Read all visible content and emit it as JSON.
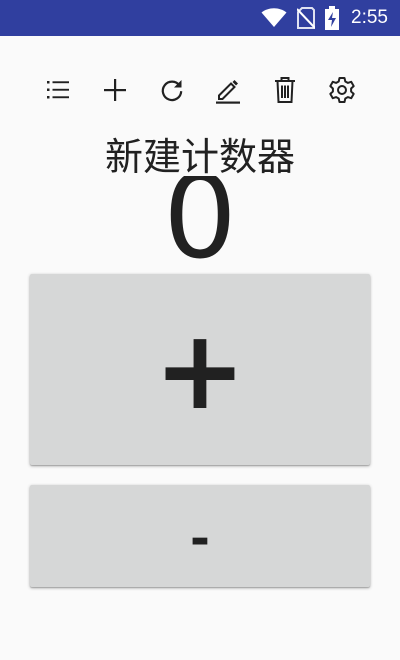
{
  "status_bar": {
    "time": "2:55",
    "background": "#303f9f",
    "icons": [
      "wifi-icon",
      "no-sim-icon",
      "battery-charging-icon"
    ]
  },
  "toolbar": {
    "icons": [
      "list-icon",
      "add-icon",
      "refresh-icon",
      "edit-icon",
      "delete-icon",
      "settings-icon"
    ]
  },
  "counter": {
    "title": "新建计数器",
    "value": "0"
  },
  "buttons": {
    "increment_label": "+",
    "decrement_label": "-",
    "background": "#d6d7d7"
  }
}
